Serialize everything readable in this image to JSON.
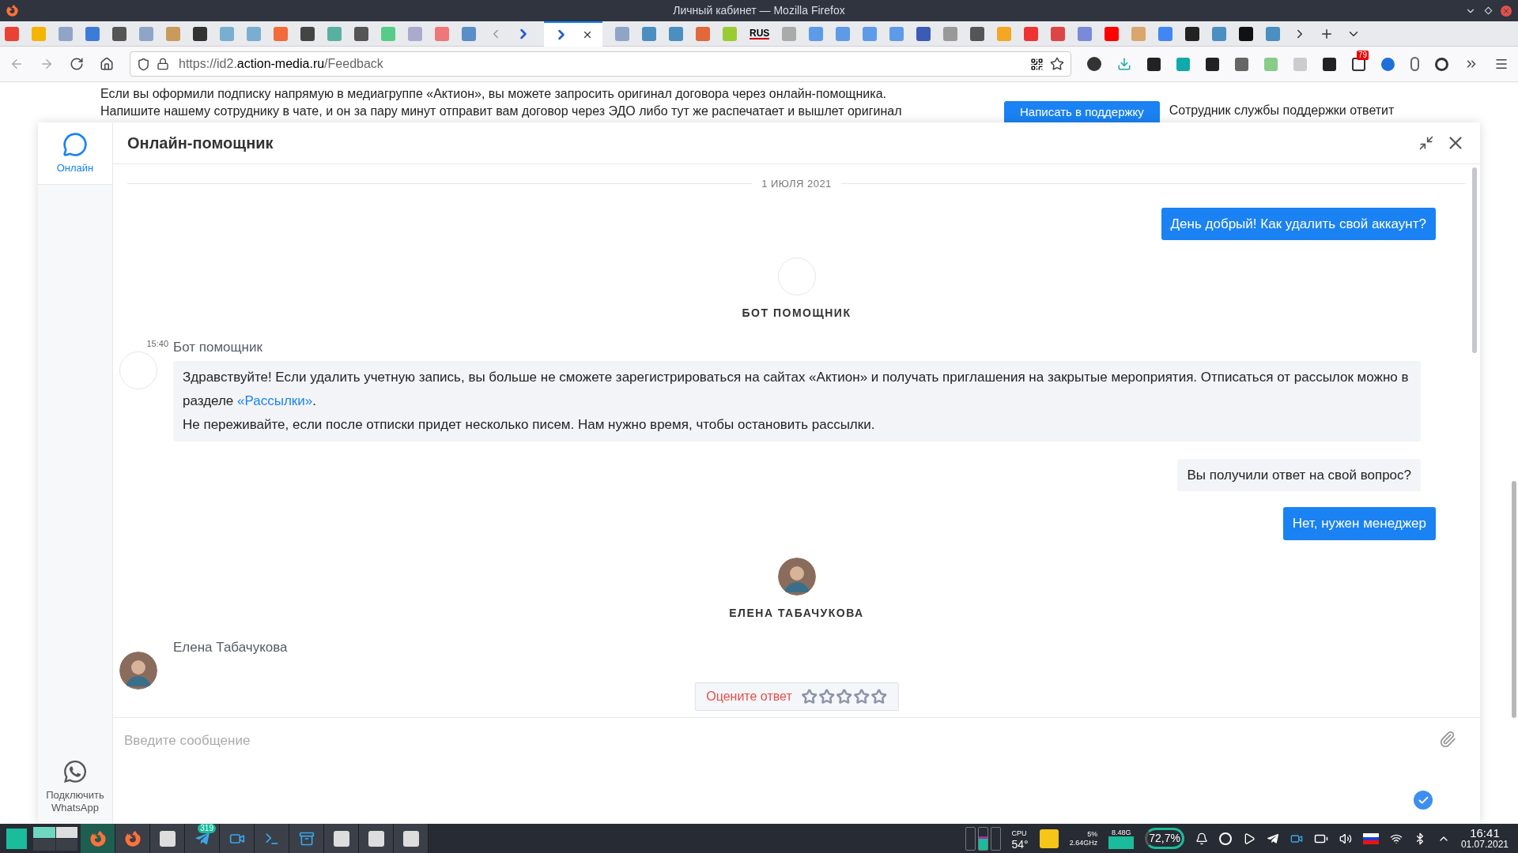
{
  "window": {
    "title": "Личный кабинет — Mozilla Firefox"
  },
  "tab_strip": {
    "text_tab": "RUS"
  },
  "address_bar": {
    "url_prefix": "https://id2.",
    "url_domain": "action-media.ru",
    "url_path": "/Feedback"
  },
  "toolbar": {
    "badge": "79"
  },
  "page": {
    "lines": [
      "Если вы оформили подписку напрямую в медиагруппе «Актион», вы можете запросить оригинал договора через онлайн-помощника.",
      "Напишите нашему сотруднику в чате, и он за пару минут отправит вам договор через ЭДО либо тут же распечатает и вышлет оригинал"
    ],
    "support_button": "Написать в поддержку",
    "side_text": "Сотрудник службы поддержки ответит"
  },
  "chat": {
    "title": "Онлайн-помощник",
    "sidebar": [
      {
        "kind": "chat",
        "label": "Онлайн",
        "selected": true
      },
      {
        "kind": "whatsapp",
        "label": "Подключить WhatsApp",
        "selected": false
      }
    ],
    "date": "1 ИЮЛЯ 2021",
    "messages": [
      {
        "kind": "outgoing",
        "text": "День добрый! Как удалить свой аккаунт?"
      },
      {
        "kind": "agent",
        "name": "БОТ ПОМОЩНИК",
        "photo": false
      },
      {
        "kind": "incoming",
        "time": "15:40",
        "author": "Бот помощник",
        "photo": false,
        "paragraphs": [
          {
            "text": "Здравствуйте! Если удалить учетную запись, вы больше не сможете зарегистрироваться на сайтах «Актион» и получать приглашения на закрытые мероприятия. Отписаться от рассылок можно в разделе ",
            "link": "«Рассылки»",
            "after": "."
          },
          {
            "text": "Не переживайте, если после отписки придет несколько писем. Нам нужно время, чтобы остановить рассылки."
          }
        ]
      },
      {
        "kind": "question",
        "text": "Вы получили ответ на свой вопрос?"
      },
      {
        "kind": "outgoing",
        "text": "Нет, нужен менеджер"
      },
      {
        "kind": "agent",
        "name": "ЕЛЕНА ТАБАЧУКОВА",
        "photo": true
      },
      {
        "kind": "incoming",
        "author": "Елена Табачукова",
        "photo": true
      }
    ],
    "rating": {
      "label": "Оцените ответ",
      "stars": 0
    },
    "input": {
      "placeholder": "Введите сообщение"
    }
  },
  "taskbar": {
    "badge": "319",
    "cpu_label": "CPU",
    "cpu_temp": "54°",
    "cpu_load": "5%",
    "cpu_freq": "2.64GHz",
    "memory": "8.48G",
    "disk": "72,7%",
    "time": "16:41",
    "date": "01.07.2021"
  }
}
